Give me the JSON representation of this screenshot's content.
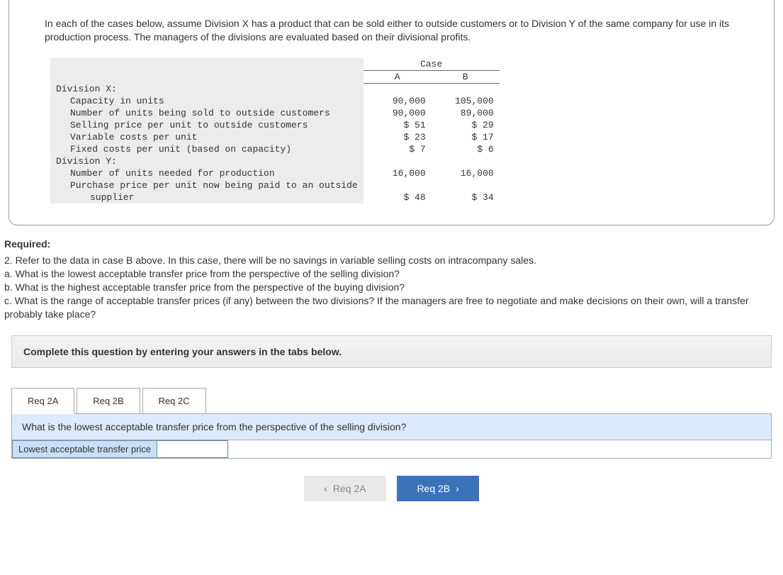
{
  "intro": "In each of the cases below, assume Division X has a product that can be sold either to outside customers or to Division Y of the same company for use in its production process. The managers of the divisions are evaluated based on their divisional profits.",
  "table": {
    "case_label": "Case",
    "col_a": "A",
    "col_b": "B",
    "divx_header": "Division X:",
    "rows_x": [
      {
        "label": "Capacity in units",
        "a": "90,000",
        "b": "105,000"
      },
      {
        "label": "Number of units being sold to outside customers",
        "a": "90,000",
        "b": "89,000"
      },
      {
        "label": "Selling price per unit to outside customers",
        "a": "$ 51",
        "b": "$ 29"
      },
      {
        "label": "Variable costs per unit",
        "a": "$ 23",
        "b": "$ 17"
      },
      {
        "label": "Fixed costs per unit (based on capacity)",
        "a": "$ 7",
        "b": "$ 6"
      }
    ],
    "divy_header": "Division Y:",
    "rows_y": [
      {
        "label": "Number of units needed for production",
        "a": "16,000",
        "b": "16,000"
      },
      {
        "label": "Purchase price per unit now being paid to an outside",
        "a": "",
        "b": ""
      },
      {
        "label": "supplier",
        "a": "$ 48",
        "b": "$ 34",
        "indent2": true
      }
    ]
  },
  "required_heading": "Required:",
  "question_block": "2. Refer to the data in case B above. In this case, there will be no savings in variable selling costs on intracompany sales.\na. What is the lowest acceptable transfer price from the perspective of the selling division?\nb. What is the highest acceptable transfer price from the perspective of the buying division?\nc. What is the range of acceptable transfer prices (if any) between the two divisions? If the managers are free to negotiate and make decisions on their own, will a transfer probably take place?",
  "instruction": "Complete this question by entering your answers in the tabs below.",
  "tabs": {
    "a": "Req 2A",
    "b": "Req 2B",
    "c": "Req 2C"
  },
  "sub_question": "What is the lowest acceptable transfer price from the perspective of the selling division?",
  "answer_label": "Lowest acceptable transfer price",
  "nav": {
    "prev": "Req 2A",
    "next": "Req 2B"
  }
}
